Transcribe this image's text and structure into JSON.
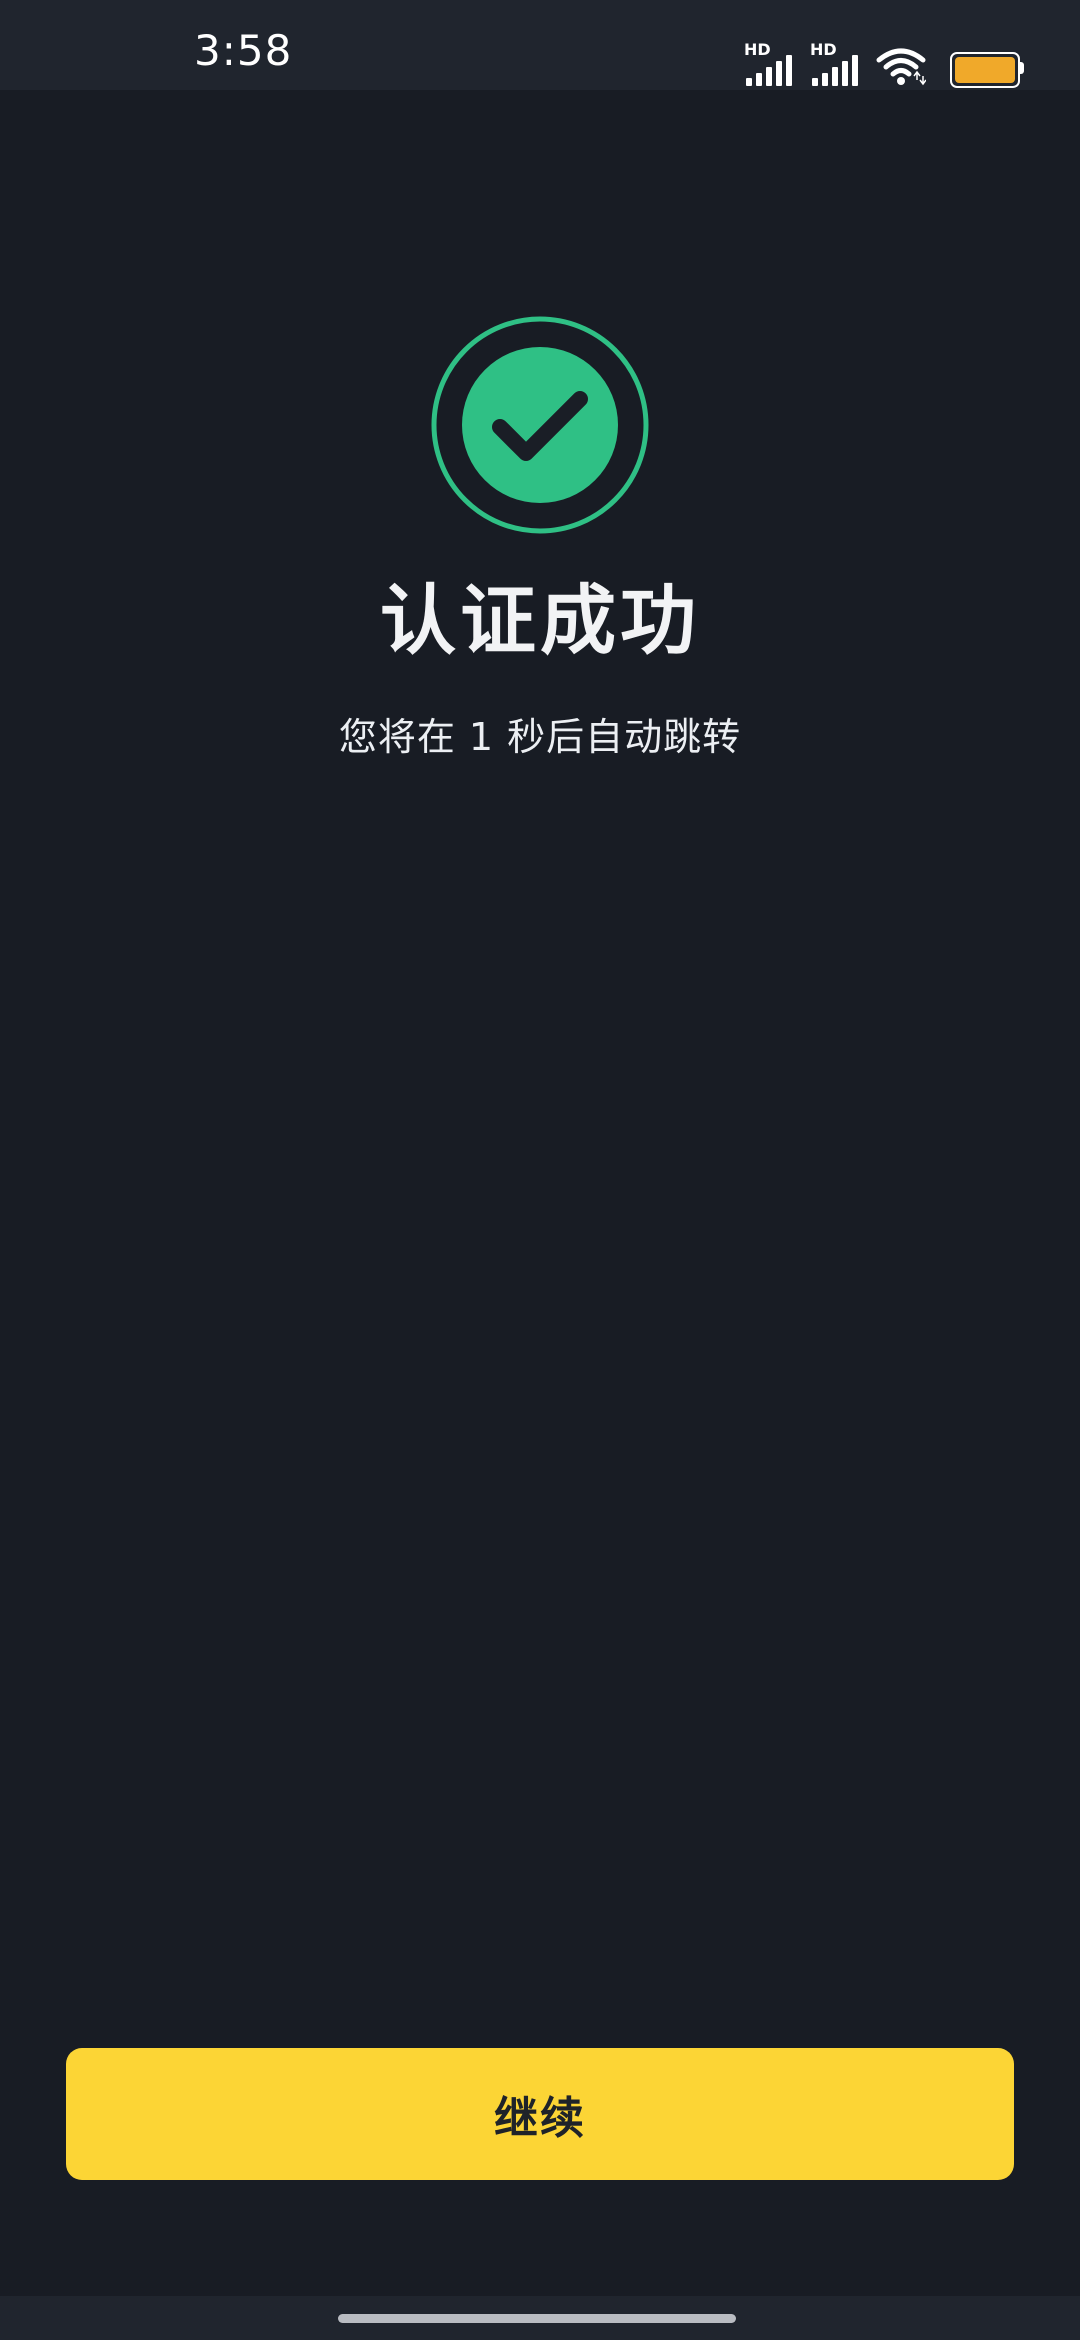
{
  "status_bar": {
    "time": "3:58",
    "signal_1_label": "HD",
    "signal_2_label": "HD",
    "icons": [
      "signal-hd-icon",
      "signal-hd-icon",
      "wifi-icon",
      "battery-icon"
    ],
    "battery_level": 1.0,
    "battery_color": "#f0a92a"
  },
  "success": {
    "icon": "check-circle-icon",
    "icon_color": "#2fc085",
    "title": "认证成功",
    "subtitle": "您将在 1 秒后自动跳转"
  },
  "actions": {
    "continue_label": "继续",
    "button_color": "#fcd535"
  }
}
